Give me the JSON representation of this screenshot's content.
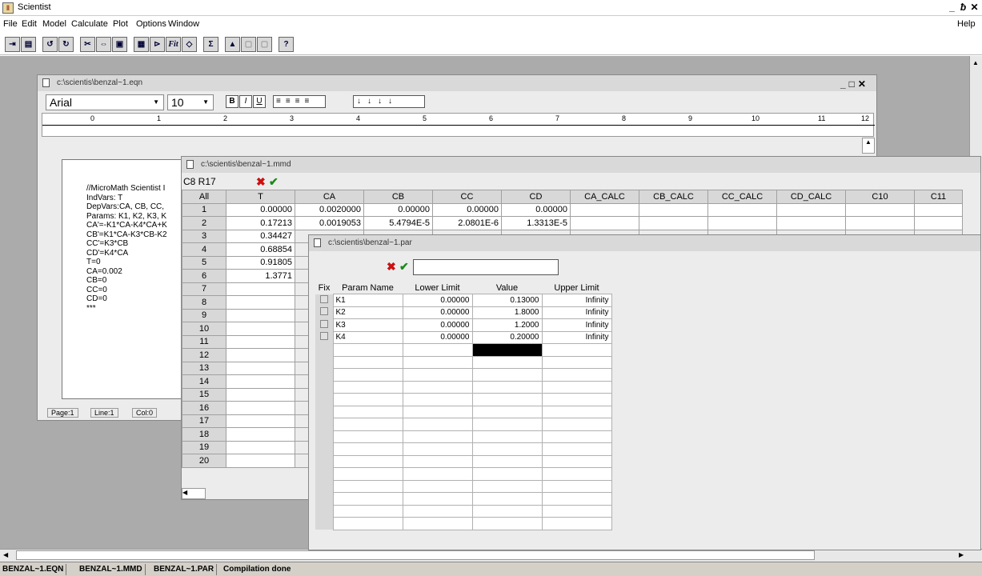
{
  "app": {
    "title": "Scientist",
    "icon": "scientist-app-icon"
  },
  "menu": [
    "File",
    "Edit",
    "Model",
    "Calculate",
    "Plot",
    "Options",
    "Window"
  ],
  "help": "Help",
  "toolbar_icons": [
    "new-icon",
    "print-icon",
    "undo-icon",
    "redo-icon",
    "cut-icon",
    "copy-icon",
    "paste-icon",
    "calc-icon",
    "plot-icon",
    "fit-icon",
    "simulate-icon",
    "sum-icon",
    "chart-icon",
    "disabled-icon-1",
    "disabled-icon-2",
    "help-icon"
  ],
  "toolbar_glyphs": [
    "⇥",
    "▤",
    "↺",
    "↻",
    "✂",
    "⇔",
    "▣",
    "▦",
    "⊳",
    "Fit",
    "◇",
    "Σ",
    "▲",
    "▢",
    "▢",
    "?"
  ],
  "eqn": {
    "title": "c:\\scientis\\benzal~1.eqn",
    "font": "Arial",
    "size": "10",
    "format_buttons": [
      "B",
      "I",
      "U"
    ],
    "ruler_numbers": [
      "0",
      "1",
      "2",
      "3",
      "4",
      "5",
      "6",
      "7",
      "8",
      "9",
      "10",
      "11",
      "12"
    ],
    "lines": [
      "//MicroMath Scientist I",
      "IndVars: T",
      "DepVars:CA, CB, CC,",
      "Params: K1, K2, K3, K",
      "CA'=-K1*CA-K4*CA+K",
      "CB'=K1*CA-K3*CB-K2",
      "CC'=K3*CB",
      "CD'=K4*CA",
      "T=0",
      "CA=0.002",
      "CB=0",
      "CC=0",
      "CD=0",
      "***"
    ],
    "status": {
      "page": "Page:1",
      "line": "Line:1",
      "col": "Col:0"
    }
  },
  "mmd": {
    "title": "c:\\scientis\\benzal~1.mmd",
    "cell_ref": "C8  R17",
    "corner": "All",
    "columns": [
      "T",
      "CA",
      "CB",
      "CC",
      "CD",
      "CA_CALC",
      "CB_CALC",
      "CC_CALC",
      "CD_CALC",
      "C10",
      "C11"
    ],
    "rows": [
      [
        "0.00000",
        "0.0020000",
        "0.00000",
        "0.00000",
        "0.00000"
      ],
      [
        "0.17213",
        "0.0019053",
        "5.4794E-5",
        "2.0801E-6",
        "1.3313E-5"
      ],
      [
        "0.34427"
      ],
      [
        "0.68854"
      ],
      [
        "0.91805"
      ],
      [
        "1.3771"
      ]
    ],
    "row_numbers": [
      "1",
      "2",
      "3",
      "4",
      "5",
      "6",
      "7",
      "8",
      "9",
      "10",
      "11",
      "12",
      "13",
      "14",
      "15",
      "16",
      "17",
      "18",
      "19",
      "20"
    ]
  },
  "par": {
    "title": "c:\\scientis\\benzal~1.par",
    "headers": {
      "fix": "Fix",
      "name": "Param Name",
      "lower": "Lower Limit",
      "value": "Value",
      "upper": "Upper Limit"
    },
    "params": [
      {
        "name": "K1",
        "lower": "0.00000",
        "value": "0.13000",
        "upper": "Infinity"
      },
      {
        "name": "K2",
        "lower": "0.00000",
        "value": "1.8000",
        "upper": "Infinity"
      },
      {
        "name": "K3",
        "lower": "0.00000",
        "value": "1.2000",
        "upper": "Infinity"
      },
      {
        "name": "K4",
        "lower": "0.00000",
        "value": "0.20000",
        "upper": "Infinity"
      }
    ]
  },
  "taskbar": [
    "BENZAL~1.EQN",
    "BENZAL~1.MMD",
    "BENZAL~1.PAR",
    "Compilation done"
  ],
  "colors": {
    "cancel": "#cc1010",
    "accept": "#1a8a1a",
    "mdi_bg": "#ababab"
  }
}
